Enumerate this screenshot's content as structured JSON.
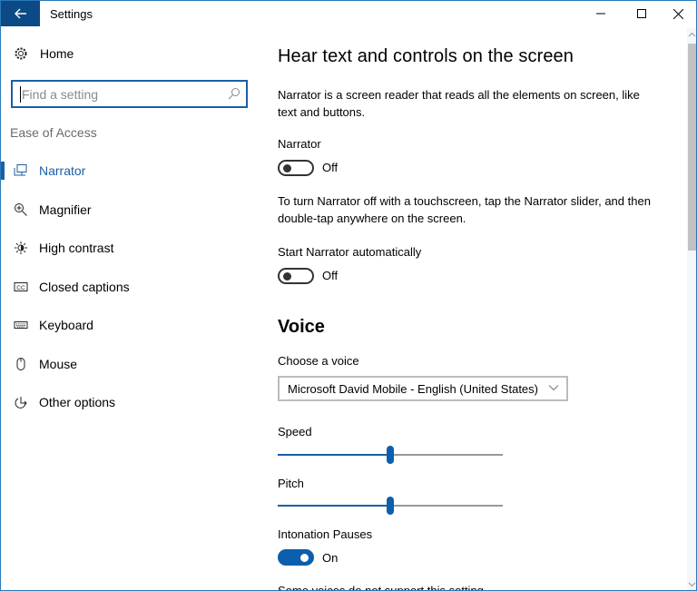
{
  "window": {
    "title": "Settings",
    "back_icon": "arrow-left-icon",
    "controls": [
      "minimize-icon",
      "maximize-icon",
      "close-icon"
    ]
  },
  "sidebar": {
    "home_label": "Home",
    "home_icon": "gear-icon",
    "search": {
      "placeholder": "Find a setting",
      "value": "",
      "icon": "search-icon"
    },
    "group_label": "Ease of Access",
    "items": [
      {
        "label": "Narrator",
        "icon": "narrator-icon",
        "active": true
      },
      {
        "label": "Magnifier",
        "icon": "magnifier-icon",
        "active": false
      },
      {
        "label": "High contrast",
        "icon": "high-contrast-icon",
        "active": false
      },
      {
        "label": "Closed captions",
        "icon": "closed-captions-icon",
        "active": false
      },
      {
        "label": "Keyboard",
        "icon": "keyboard-icon",
        "active": false
      },
      {
        "label": "Mouse",
        "icon": "mouse-icon",
        "active": false
      },
      {
        "label": "Other options",
        "icon": "other-options-icon",
        "active": false
      }
    ]
  },
  "main": {
    "title": "Hear text and controls on the screen",
    "intro": "Narrator is a screen reader that reads all the elements on screen, like text and buttons.",
    "narrator": {
      "label": "Narrator",
      "state": "Off",
      "on": false
    },
    "touch_note": "To turn Narrator off with a touchscreen, tap the Narrator slider, and then double-tap anywhere on the screen.",
    "start_auto": {
      "label": "Start Narrator automatically",
      "state": "Off",
      "on": false
    },
    "voice_heading": "Voice",
    "choose_voice": {
      "label": "Choose a voice",
      "selected": "Microsoft David Mobile - English (United States)"
    },
    "speed": {
      "label": "Speed",
      "value_fraction": 0.5
    },
    "pitch": {
      "label": "Pitch",
      "value_fraction": 0.5
    },
    "intonation": {
      "label": "Intonation Pauses",
      "state": "On",
      "on": true
    },
    "cutoff_text": "Some voices do not support this setting."
  },
  "colors": {
    "accent": "#0b5fad",
    "titlebar_back": "#0b4a84"
  }
}
